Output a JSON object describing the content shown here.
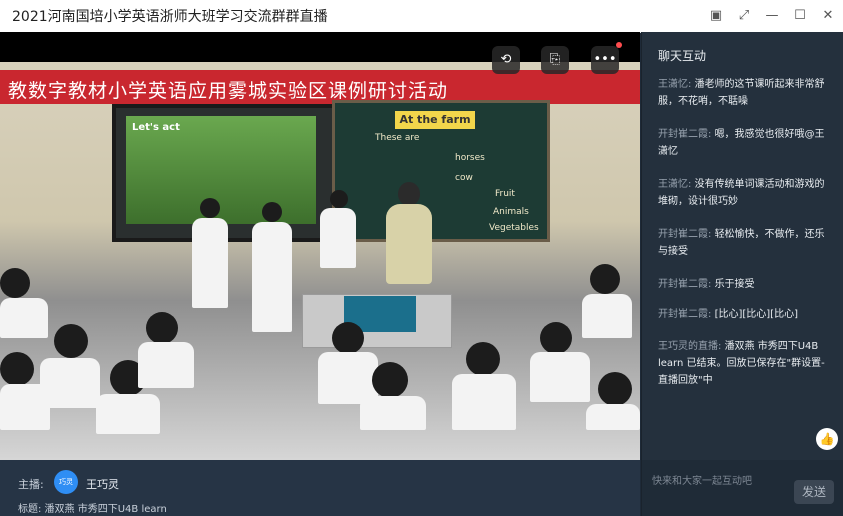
{
  "window": {
    "title": "2021河南国培小学英语浙师大班学习交流群群直播"
  },
  "video": {
    "banner_text": "教数字教材小学英语应用雾城实验区课例研讨活动",
    "screen_label": "Let's act",
    "board_title": "At the farm",
    "board_words": [
      "These are",
      "horses",
      "Fruit",
      "cow",
      "Animals",
      "Vegetables"
    ]
  },
  "footer": {
    "host_label": "主播:",
    "host_avatar_text": "巧灵",
    "host_name": "王巧灵",
    "topic": "标题: 潘双燕 市秀四下U4B learn"
  },
  "chat": {
    "header": "聊天互动",
    "messages": [
      {
        "name": "王潇忆:",
        "text": "潘老师的这节课听起来非常舒服，不花哨，不聒噪"
      },
      {
        "name": "开封崔二霞:",
        "text": "嗯，我感觉也很好哦@王潇忆"
      },
      {
        "name": "王潇忆:",
        "text": "没有传统单词课活动和游戏的堆砌，设计很巧妙"
      },
      {
        "name": "开封崔二霞:",
        "text": "轻松愉快，不做作，还乐与接受"
      },
      {
        "name": "开封崔二霞:",
        "text": "乐于接受"
      },
      {
        "name": "开封崔二霞:",
        "text": "[比心][比心][比心]"
      },
      {
        "name": "王巧灵的直播:",
        "text": "潘双燕 市秀四下U4B learn 已结束。回放已保存在\"群设置-直播回放\"中"
      }
    ],
    "input_placeholder": "快来和大家一起互动吧",
    "send_label": "发送"
  },
  "colors": {
    "chat_bg": "#24303d",
    "footer_bg": "#263445",
    "banner_red": "#c9272f",
    "avatar_blue": "#2f8ef4"
  }
}
